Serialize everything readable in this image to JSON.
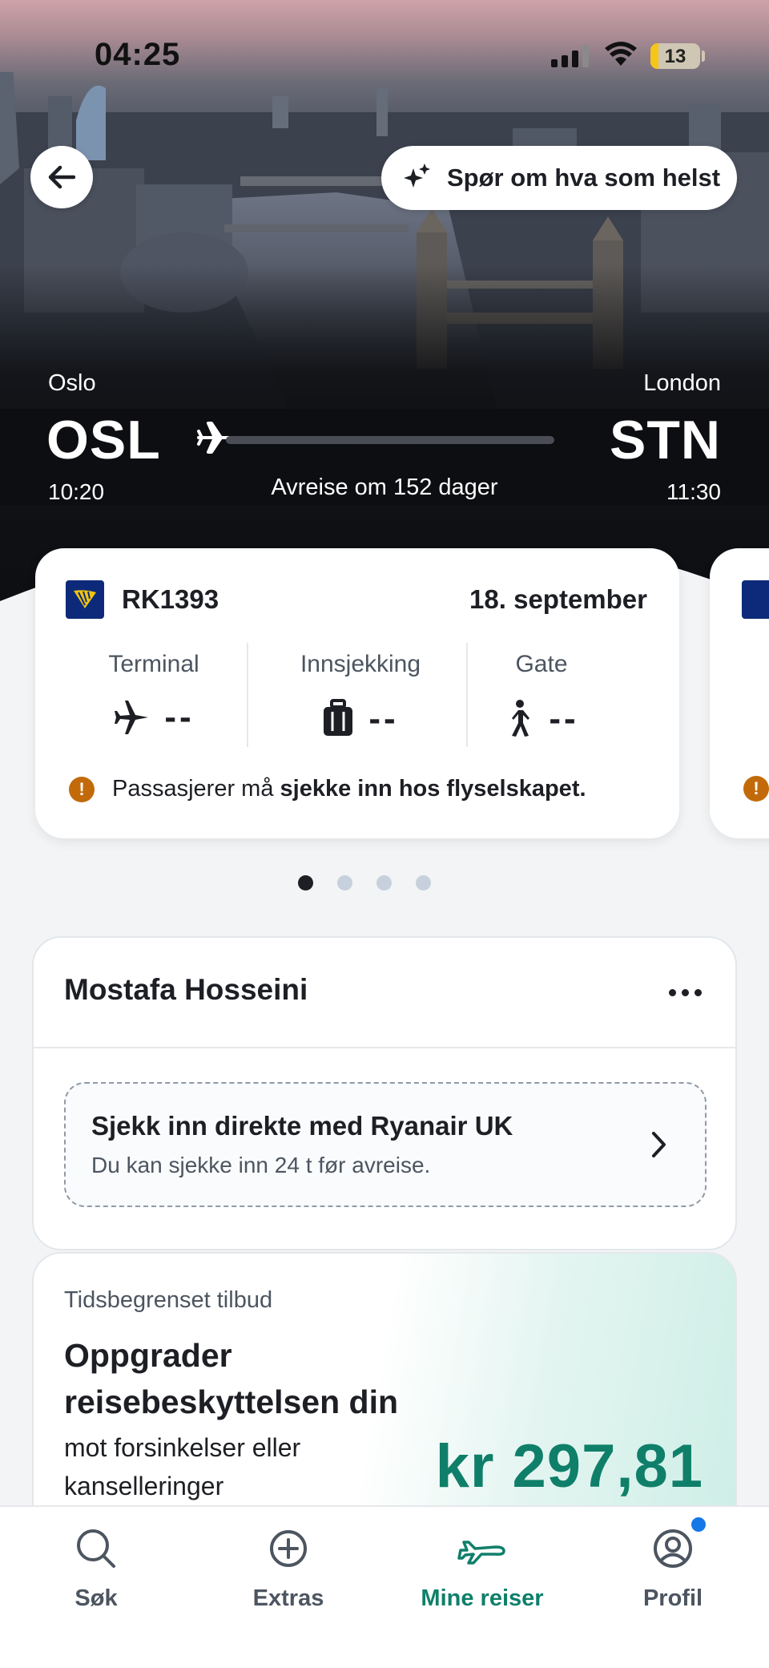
{
  "status_bar": {
    "time": "04:25",
    "battery": "13"
  },
  "header": {
    "ask_label": "Spør om hva som helst"
  },
  "route": {
    "from_city": "Oslo",
    "from_code": "OSL",
    "from_time": "10:20",
    "to_city": "London",
    "to_code": "STN",
    "to_time": "11:30",
    "departure_note": "Avreise om 152 dager"
  },
  "flight_card": {
    "flight_number": "RK1393",
    "date": "18. september",
    "terminal_label": "Terminal",
    "terminal_value": "--",
    "checkin_label": "Innsjekking",
    "checkin_value": "--",
    "gate_label": "Gate",
    "gate_value": "--",
    "notice_prefix": "Passasjerer må ",
    "notice_bold": "sjekke inn hos flyselskapet."
  },
  "pager": {
    "count": 4,
    "active_index": 0
  },
  "passenger": {
    "name": "Mostafa Hosseini",
    "checkin_title": "Sjekk inn direkte med Ryanair UK",
    "checkin_subtitle": "Du kan sjekke inn 24 t før avreise."
  },
  "offer": {
    "tag": "Tidsbegrenset tilbud",
    "title": "Oppgrader reisebeskyttelsen din",
    "subtitle": "mot forsinkelser eller kanselleringer",
    "price": "kr 297,81"
  },
  "tabs": [
    {
      "label": "Søk",
      "icon": "search-icon"
    },
    {
      "label": "Extras",
      "icon": "plus-circle-icon"
    },
    {
      "label": "Mine reiser",
      "icon": "plane-icon"
    },
    {
      "label": "Profil",
      "icon": "profile-icon"
    }
  ],
  "colors": {
    "accent": "#0f7f6a",
    "warning": "#c26a0a",
    "badge": "#1677e6",
    "airline_logo": "#0d2a7a"
  }
}
